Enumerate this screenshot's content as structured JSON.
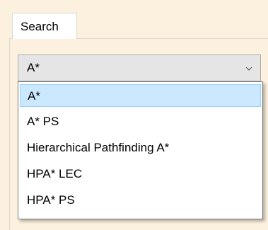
{
  "tabs": [
    {
      "label": "Search"
    }
  ],
  "combo": {
    "value": "A*",
    "options": [
      {
        "label": "A*",
        "selected": true
      },
      {
        "label": "A* PS",
        "selected": false
      },
      {
        "label": "Hierarchical Pathfinding A*",
        "selected": false
      },
      {
        "label": "HPA* LEC",
        "selected": false
      },
      {
        "label": "HPA* PS",
        "selected": false
      }
    ]
  },
  "icons": {
    "dropdown_arrow": "chevron-down-icon"
  },
  "colors": {
    "panel_background": "#fcf1de",
    "selected_item_background": "#cce8ff",
    "selected_item_border": "#99d1ff",
    "combo_background": "#e5e5e5"
  }
}
